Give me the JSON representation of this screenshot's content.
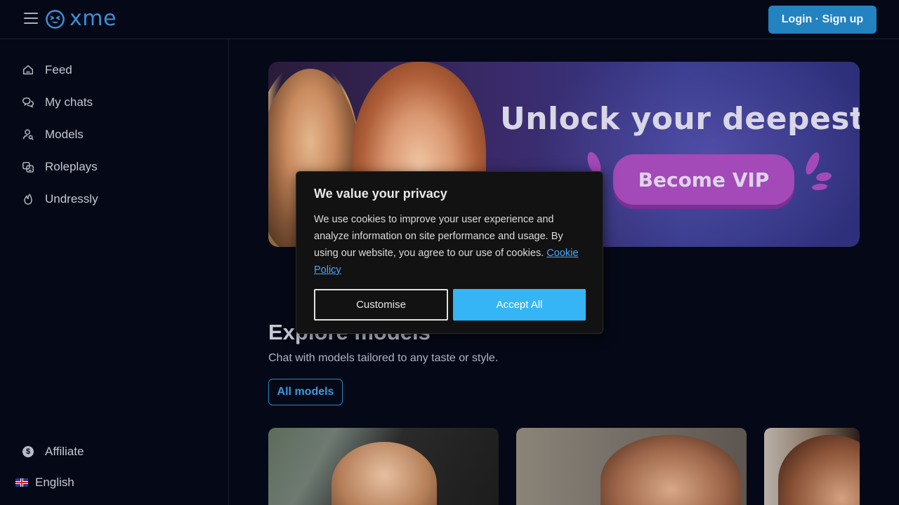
{
  "header": {
    "logo_text": "xme",
    "login_label": "Login · Sign up"
  },
  "sidebar": {
    "items": [
      {
        "label": "Feed",
        "icon": "home-icon"
      },
      {
        "label": "My chats",
        "icon": "chat-bubbles-icon"
      },
      {
        "label": "Models",
        "icon": "user-search-icon"
      },
      {
        "label": "Roleplays",
        "icon": "masks-icon"
      },
      {
        "label": "Undressly",
        "icon": "flame-icon"
      }
    ],
    "affiliate_label": "Affiliate",
    "affiliate_icon_glyph": "$",
    "language_label": "English"
  },
  "banner": {
    "title": "Unlock your deepest desi",
    "cta_label": "Become VIP"
  },
  "explore": {
    "title": "Explore models",
    "subtitle": "Chat with models tailored to any taste or style.",
    "all_models_label": "All models"
  },
  "cookie": {
    "title": "We value your privacy",
    "body": "We use cookies to improve your user experience and analyze information on site performance and usage. By using our website, you agree to our use of cookies.",
    "link_label": "Cookie Policy",
    "customise_label": "Customise",
    "accept_label": "Accept All"
  },
  "colors": {
    "background": "#050816",
    "accent": "#2382c0",
    "vip": "#a349b8",
    "cookie_accept": "#35b5f5"
  }
}
